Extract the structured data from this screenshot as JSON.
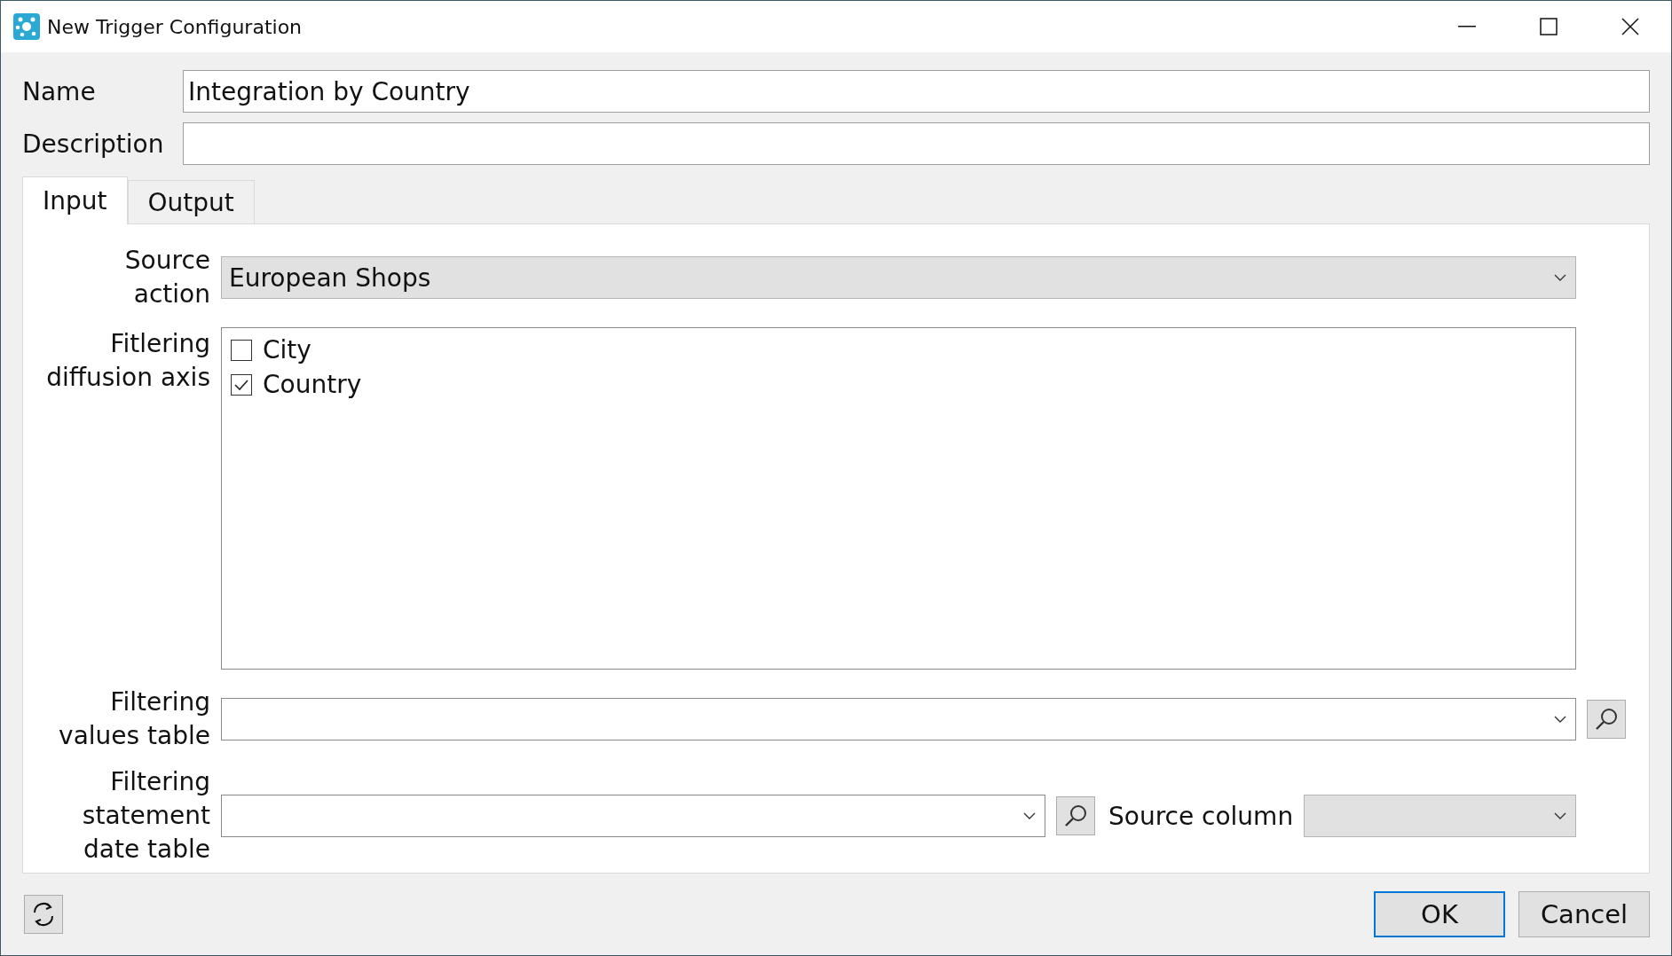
{
  "window": {
    "title": "New Trigger Configuration"
  },
  "name_field": {
    "label": "Name",
    "value": "Integration by Country"
  },
  "description_field": {
    "label": "Description"
  },
  "tabs": [
    {
      "label": "Input",
      "selected": true
    },
    {
      "label": "Output",
      "selected": false
    }
  ],
  "input_panel": {
    "source_action": {
      "label": "Source\naction",
      "value": "European Shops",
      "editable": false
    },
    "diffusion_axis": {
      "label": "Fitlering\ndiffusion axis",
      "items": [
        {
          "label": "City",
          "checked": false
        },
        {
          "label": "Country",
          "checked": true
        }
      ]
    },
    "filtering_values_table": {
      "label": "Filtering\nvalues table",
      "editable": true
    },
    "filtering_statement_date_table": {
      "label": "Filtering\nstatement\ndate table",
      "editable": true
    },
    "source_column": {
      "label": "Source column",
      "editable": false
    }
  },
  "buttons": [
    {
      "label": "OK",
      "default": true
    },
    {
      "label": "Cancel",
      "default": false
    }
  ]
}
